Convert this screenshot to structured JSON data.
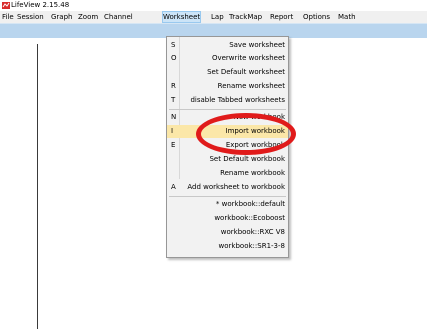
{
  "window": {
    "title": "LifeView 2.15.48"
  },
  "menubar": {
    "items": [
      {
        "label": "File",
        "id": "file"
      },
      {
        "label": "Session",
        "id": "session"
      },
      {
        "label": "Graph",
        "id": "graph"
      },
      {
        "label": "Zoom",
        "id": "zoom"
      },
      {
        "label": "Channel",
        "id": "channel"
      },
      {
        "label": "Worksheet",
        "id": "worksheet"
      },
      {
        "label": "Lap",
        "id": "lap"
      },
      {
        "label": "TrackMap",
        "id": "trackmap"
      },
      {
        "label": "Report",
        "id": "report"
      },
      {
        "label": "Options",
        "id": "options"
      },
      {
        "label": "Math",
        "id": "math"
      }
    ]
  },
  "worksheet_menu": {
    "items": [
      {
        "key": "S",
        "label": "Save worksheet"
      },
      {
        "key": "O",
        "label": "Overwrite worksheet"
      },
      {
        "key": "",
        "label": "Set Default worksheet"
      },
      {
        "key": "R",
        "label": "Rename worksheet"
      },
      {
        "key": "T",
        "label": "disable Tabbed worksheets"
      },
      {
        "key": "N",
        "label": "New workbook"
      },
      {
        "key": "I",
        "label": "Import workbook",
        "highlighted": true
      },
      {
        "key": "E",
        "label": "Export workbook"
      },
      {
        "key": "",
        "label": "Set Default workbook"
      },
      {
        "key": "",
        "label": "Rename workbook"
      },
      {
        "key": "A",
        "label": "Add worksheet to workbook"
      },
      {
        "key": "",
        "label": "* workbook::default"
      },
      {
        "key": "",
        "label": "workbook::Ecoboost"
      },
      {
        "key": "",
        "label": "workbook::RXC V8"
      },
      {
        "key": "",
        "label": "workbook::SR1-3-8"
      }
    ]
  },
  "colors": {
    "accent": "#e01b1b",
    "highlight": "#fbe7a8",
    "toolbar": "#b9d5ee"
  }
}
